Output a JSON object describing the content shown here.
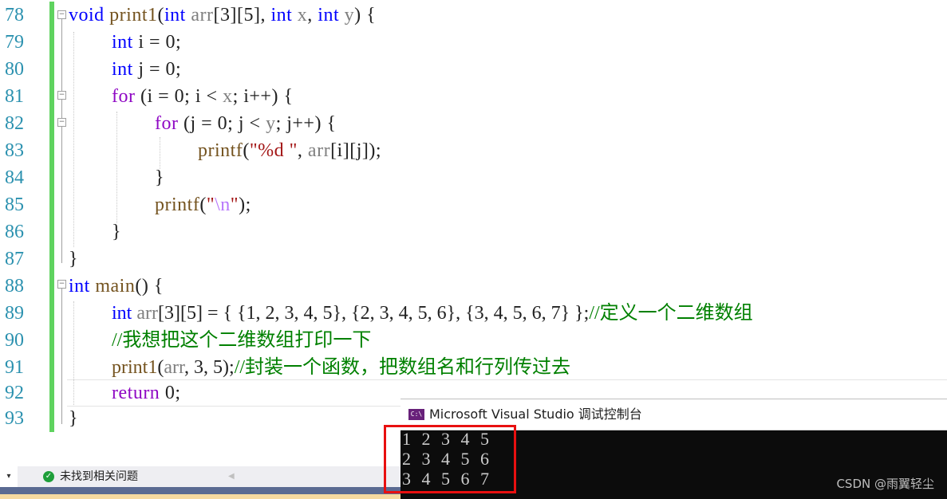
{
  "editor": {
    "lines": [
      {
        "number": "78",
        "text": "void print1(int arr[3][5], int x, int y) {"
      },
      {
        "number": "79",
        "text": "int i = 0;"
      },
      {
        "number": "80",
        "text": "int j = 0;"
      },
      {
        "number": "81",
        "text": "for (i = 0; i < x; i++) {"
      },
      {
        "number": "82",
        "text": "for (j = 0; j < y; j++) {"
      },
      {
        "number": "83",
        "text": "printf(\"%d \", arr[i][j]);"
      },
      {
        "number": "84",
        "text": "}"
      },
      {
        "number": "85",
        "text": "printf(\"\\n\");"
      },
      {
        "number": "86",
        "text": "}"
      },
      {
        "number": "87",
        "text": "}"
      },
      {
        "number": "88",
        "text": "int main() {"
      },
      {
        "number": "89",
        "text": "int arr[3][5] = { {1,2,3,4,5},{2,3,4,5,6},{3,4,5,6,7} };//定义一个二维数组"
      },
      {
        "number": "90",
        "text": "//我想把这个二维数组打印一下"
      },
      {
        "number": "91",
        "text": "print1(arr,3,5);//封装一个函数，把数组名和行列传过去"
      },
      {
        "number": "92",
        "text": "return 0;"
      },
      {
        "number": "93",
        "text": "}"
      }
    ],
    "tokens": {
      "l78": [
        "void",
        " ",
        "print1",
        "(",
        "int",
        " ",
        "arr",
        "[3][5], ",
        "int",
        " ",
        "x",
        ", ",
        "int",
        " ",
        "y",
        ") {"
      ],
      "l79": [
        "int",
        " i = 0;"
      ],
      "l80": [
        "int",
        " j = 0;"
      ],
      "l81": [
        "for",
        " (i = 0; i < ",
        "x",
        "; i++) {"
      ],
      "l82": [
        "for",
        " (j = 0; j < ",
        "y",
        "; j++) {"
      ],
      "l83": [
        "printf",
        "(",
        "\"%d \"",
        ", ",
        "arr",
        "[i][j]);"
      ],
      "l84": [
        "}"
      ],
      "l85": [
        "printf",
        "(",
        "\"",
        "\\n",
        "\"",
        ");"
      ],
      "l86": [
        "}"
      ],
      "l87": [
        "}"
      ],
      "l88": [
        "int",
        " ",
        "main",
        "() {"
      ],
      "l89": [
        "int",
        " ",
        "arr",
        "[3][5] = { {1, 2, 3, 4, 5}, {2, 3, 4, 5, 6}, {3, 4, 5, 6, 7} };",
        "//定义一个二维数组"
      ],
      "l90": [
        "//我想把这个二维数组打印一下"
      ],
      "l91": [
        "print1",
        "(",
        "arr",
        ", 3, 5);",
        "//封装一个函数，把数组名和行列传过去"
      ],
      "l92": [
        "return",
        " 0;"
      ],
      "l93": [
        "}"
      ]
    }
  },
  "statusbar": {
    "dropdown_icon": "chevron-down",
    "status_icon": "check-circle",
    "status_text": "未找到相关问题",
    "scroll_icon": "scroll-left"
  },
  "console": {
    "title": "Microsoft Visual Studio 调试控制台",
    "icon_label": "C:\\",
    "output": [
      "1 2 3 4 5",
      "2 3 4 5 6",
      "3 4 5 6 7"
    ]
  },
  "watermark": "CSDN @雨翼轻尘",
  "colors": {
    "keyword": "#0000ff",
    "control_keyword": "#8f08c4",
    "function": "#74531f",
    "comment": "#008000",
    "string": "#a31515",
    "line_number": "#2b91af",
    "change_bar": "#5fd35f",
    "highlight_box": "#e81010"
  }
}
